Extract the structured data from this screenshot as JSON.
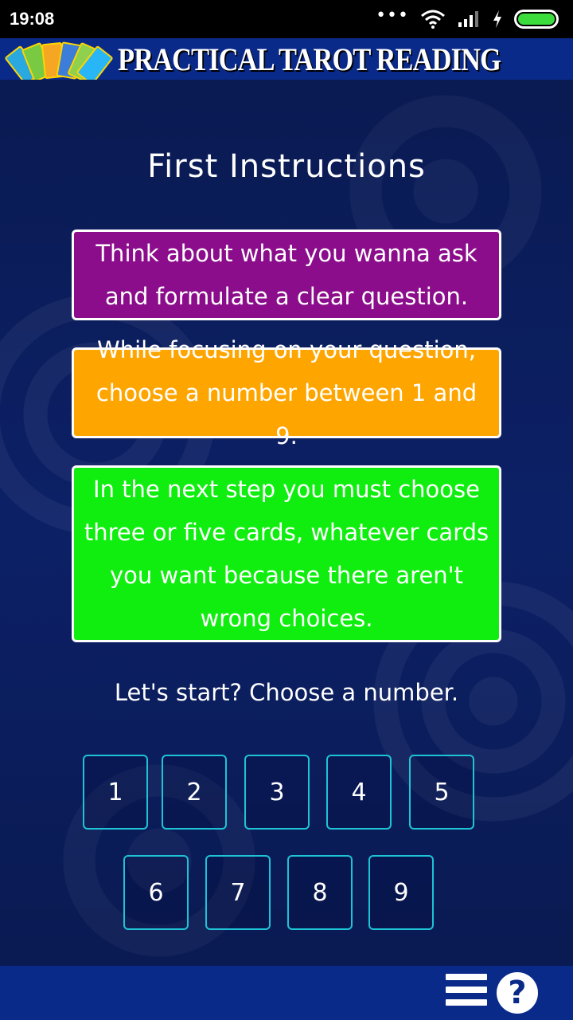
{
  "status_bar": {
    "time": "19:08",
    "dots": "•••",
    "icons": [
      "wifi-icon",
      "signal-icon",
      "charging-icon",
      "battery-icon"
    ]
  },
  "header": {
    "title": "PRACTICAL TAROT READING"
  },
  "main": {
    "title": "First Instructions",
    "instructions": [
      "Think about what you wanna ask and formulate a clear question.",
      "While focusing on your question, choose a number between 1 and 9.",
      "In the next step you must choose three or five cards, whatever cards you want because there aren't wrong choices."
    ],
    "prompt": "Let's start? Choose a number.",
    "numbers": [
      "1",
      "2",
      "3",
      "4",
      "5",
      "6",
      "7",
      "8",
      "9"
    ]
  },
  "bottom_bar": {
    "menu_icon": "menu-icon",
    "help_label": "?"
  },
  "colors": {
    "background": "#0b1a55",
    "banner": "#0a2a8a",
    "instruction_1": "#8b0d8b",
    "instruction_2": "#ffa500",
    "instruction_3": "#10ee10",
    "number_border": "#1ec3d6"
  }
}
